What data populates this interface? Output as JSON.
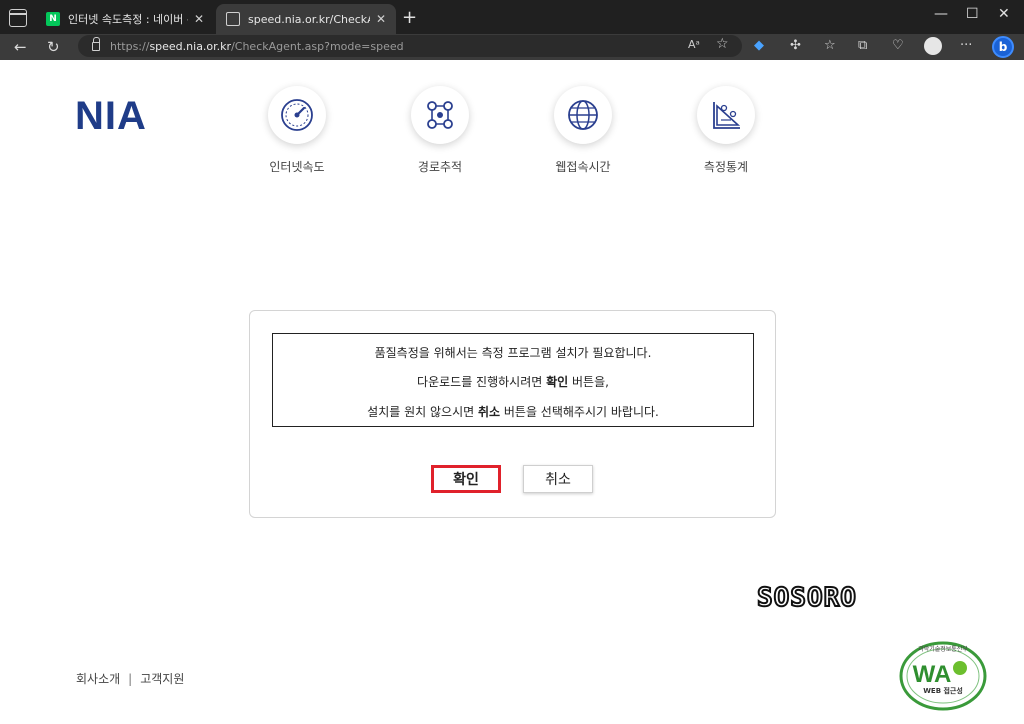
{
  "browser": {
    "tabs": [
      {
        "title": "인터넷 속도측정 : 네이버 통합검",
        "favicon": "naver-icon",
        "active": false
      },
      {
        "title": "speed.nia.or.kr/CheckAgent.asp?m",
        "favicon": "page-icon",
        "active": true
      }
    ],
    "address": {
      "prefix": "https://",
      "host": "speed.nia.or.kr",
      "path": "/CheckAgent.asp?mode=speed"
    }
  },
  "header": {
    "logo": "NIA",
    "menu": [
      {
        "label": "인터넷속도",
        "icon": "speedometer-icon"
      },
      {
        "label": "경로추적",
        "icon": "route-icon"
      },
      {
        "label": "웹접속시간",
        "icon": "globe-icon"
      },
      {
        "label": "측정통계",
        "icon": "statistics-icon"
      }
    ]
  },
  "dialog": {
    "line1": "품질측정을 위해서는 측정 프로그램 설치가 필요합니다.",
    "line2_pre": "다운로드를 진행하시려면 ",
    "line2_bold": "확인",
    "line2_post": " 버튼을,",
    "line3_pre": "설치를 원치 않으시면 ",
    "line3_bold": "취소",
    "line3_post": " 버튼을 선택해주시기 바랍니다.",
    "ok_label": "확인",
    "cancel_label": "취소"
  },
  "watermark": "SOSORO",
  "footer": {
    "links": [
      "회사소개",
      "고객지원"
    ],
    "separator": "|"
  },
  "badge": {
    "text": "WA",
    "sub": "WEB 접근성",
    "top": "과학기술정보통신부"
  },
  "colors": {
    "brand": "#1f3c88",
    "ok_border": "#e0212b"
  }
}
